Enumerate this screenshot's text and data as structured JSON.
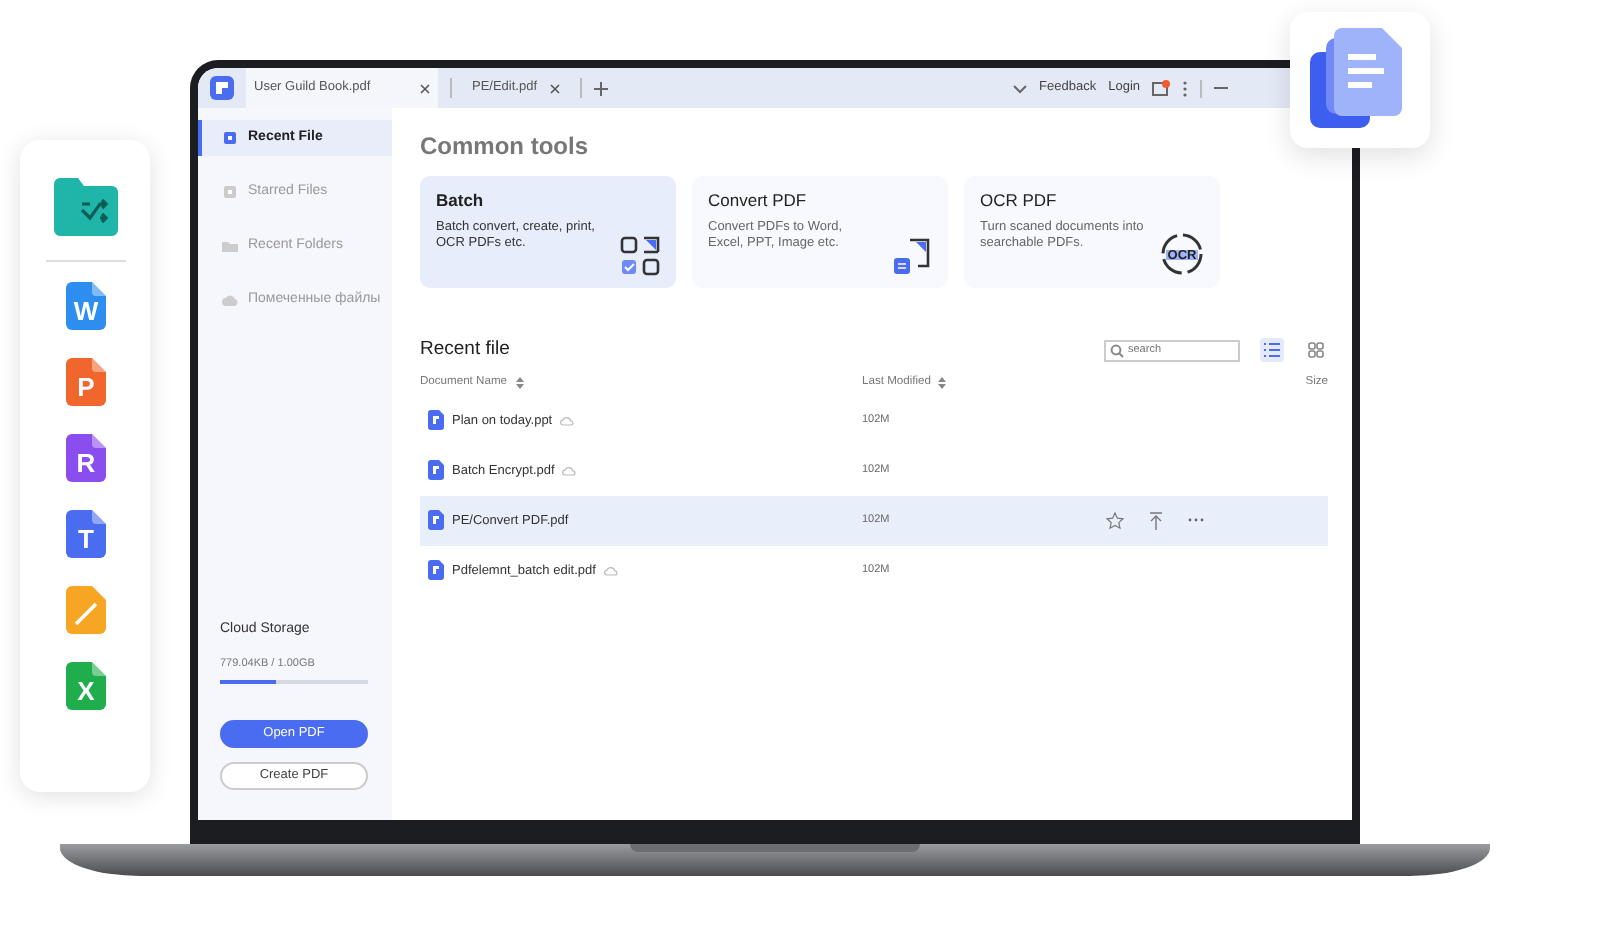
{
  "dock": {
    "apps": [
      {
        "kind": "folder",
        "color": "#1fb5a8"
      },
      {
        "kind": "doc",
        "letter": "W",
        "color": "#2e8ef0"
      },
      {
        "kind": "doc",
        "letter": "P",
        "color": "#f0662c"
      },
      {
        "kind": "doc",
        "letter": "R",
        "color": "#8a4ef0"
      },
      {
        "kind": "doc",
        "letter": "T",
        "color": "#4a6cf0"
      },
      {
        "kind": "pen",
        "color": "#f6a623"
      },
      {
        "kind": "doc",
        "letter": "X",
        "color": "#1fae4b"
      }
    ]
  },
  "tabs": [
    {
      "label": "User Guild Book.pdf",
      "selected": true
    },
    {
      "label": "PE/Edit.pdf",
      "selected": false
    }
  ],
  "title_bar": {
    "links": [
      "Feedback",
      "Login"
    ]
  },
  "sidebar": {
    "items": [
      {
        "label": "Recent File",
        "kind": "recent",
        "selected": true
      },
      {
        "label": "Starred Files",
        "kind": "star",
        "selected": false
      },
      {
        "label": "Recent Folders",
        "kind": "folder",
        "selected": false
      },
      {
        "label": "Помеченные файлы",
        "kind": "cloud",
        "selected": false
      }
    ],
    "storage": {
      "title": "Cloud Storage",
      "reading": "779.04KB / 1.00GB",
      "level": 0.38
    },
    "buttons": [
      {
        "label": "Open PDF",
        "kind": "primary"
      },
      {
        "label": "Create PDF",
        "kind": "outline"
      }
    ]
  },
  "common_tools": {
    "title": "Common tools",
    "tools": [
      {
        "kind": "batch",
        "title": "Batch",
        "description": "Batch convert, create, print, OCR  PDFs etc.",
        "selected": true
      },
      {
        "kind": "convert",
        "title": "Convert PDF",
        "description": "Convert PDFs to Word, Excel, PPT, Image etc.",
        "selected": false
      },
      {
        "kind": "ocr",
        "title": "OCR PDF",
        "description": "Turn scaned documents into searchable PDFs.",
        "icon_text": "OCR",
        "selected": false
      }
    ]
  },
  "recent": {
    "title": "Recent file",
    "search": {
      "placeholder": "search"
    },
    "views": [
      {
        "kind": "list",
        "selected": true
      },
      {
        "kind": "grid",
        "selected": false
      }
    ],
    "columns": [
      "Document Name",
      "Last Modified",
      "Size"
    ],
    "rows": [
      {
        "name": "Plan on today.ppt",
        "modified": "102M",
        "cloud": true,
        "selected": false
      },
      {
        "name": "Batch Encrypt.pdf",
        "modified": "102M",
        "cloud": true,
        "selected": false
      },
      {
        "name": "PE/Convert PDF.pdf",
        "modified": "102M",
        "cloud": false,
        "selected": true
      },
      {
        "name": "Pdfelemnt_batch edit.pdf",
        "modified": "102M",
        "cloud": true,
        "selected": false
      }
    ]
  }
}
